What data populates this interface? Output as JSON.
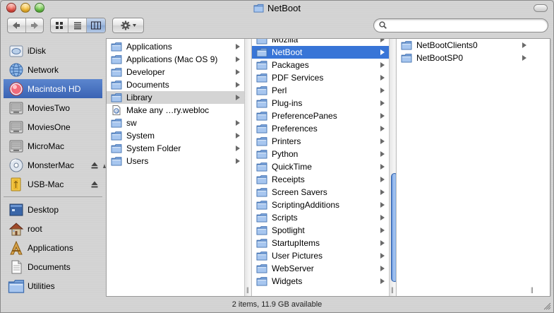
{
  "window": {
    "title": "NetBoot"
  },
  "toolbar": {
    "back_label": "Back",
    "forward_label": "Forward",
    "view_icon": "icon-view",
    "view_list": "list-view",
    "view_column": "column-view",
    "action_icon": "gear-icon"
  },
  "search": {
    "placeholder": "",
    "value": ""
  },
  "sidebar": {
    "devices": [
      {
        "label": "iDisk",
        "icon": "idisk-icon"
      },
      {
        "label": "Network",
        "icon": "network-globe-icon"
      },
      {
        "label": "Macintosh HD",
        "icon": "hard-disk-icon",
        "selected": true
      },
      {
        "label": "MoviesTwo",
        "icon": "drive-icon"
      },
      {
        "label": "MoviesOne",
        "icon": "drive-icon"
      },
      {
        "label": "MicroMac",
        "icon": "drive-icon"
      },
      {
        "label": "MonsterMac",
        "icon": "disk-icon",
        "eject": true
      },
      {
        "label": "USB-Mac",
        "icon": "usb-drive-icon",
        "eject": true
      }
    ],
    "places": [
      {
        "label": "Desktop",
        "icon": "desktop-icon"
      },
      {
        "label": "root",
        "icon": "home-icon"
      },
      {
        "label": "Applications",
        "icon": "applications-icon"
      },
      {
        "label": "Documents",
        "icon": "documents-icon"
      },
      {
        "label": "Utilities",
        "icon": "folder-icon"
      }
    ]
  },
  "columns": [
    {
      "items": [
        {
          "label": "Applications",
          "arrow": true
        },
        {
          "label": "Applications (Mac OS 9)",
          "arrow": true
        },
        {
          "label": "Developer",
          "arrow": true
        },
        {
          "label": "Documents",
          "arrow": true
        },
        {
          "label": "Library",
          "arrow": true,
          "state": "path"
        },
        {
          "label": "Make any …ry.webloc",
          "arrow": false,
          "icon": "webloc-icon"
        },
        {
          "label": "sw",
          "arrow": true
        },
        {
          "label": "System",
          "arrow": true
        },
        {
          "label": "System Folder",
          "arrow": true
        },
        {
          "label": "Users",
          "arrow": true
        }
      ]
    },
    {
      "items": [
        {
          "label": "Mozilla",
          "arrow": true
        },
        {
          "label": "NetBoot",
          "arrow": true,
          "state": "selected"
        },
        {
          "label": "Packages",
          "arrow": true
        },
        {
          "label": "PDF Services",
          "arrow": true
        },
        {
          "label": "Perl",
          "arrow": true
        },
        {
          "label": "Plug-ins",
          "arrow": true
        },
        {
          "label": "PreferencePanes",
          "arrow": true
        },
        {
          "label": "Preferences",
          "arrow": true
        },
        {
          "label": "Printers",
          "arrow": true
        },
        {
          "label": "Python",
          "arrow": true
        },
        {
          "label": "QuickTime",
          "arrow": true
        },
        {
          "label": "Receipts",
          "arrow": true
        },
        {
          "label": "Screen Savers",
          "arrow": true
        },
        {
          "label": "ScriptingAdditions",
          "arrow": true
        },
        {
          "label": "Scripts",
          "arrow": true
        },
        {
          "label": "Spotlight",
          "arrow": true
        },
        {
          "label": "StartupItems",
          "arrow": true
        },
        {
          "label": "User Pictures",
          "arrow": true
        },
        {
          "label": "WebServer",
          "arrow": true
        },
        {
          "label": "Widgets",
          "arrow": true
        }
      ]
    },
    {
      "items": [
        {
          "label": "NetBootClients0",
          "arrow": true
        },
        {
          "label": "NetBootSP0",
          "arrow": true
        }
      ]
    }
  ],
  "status": {
    "text": "2 items, 11.9 GB available"
  },
  "colors": {
    "selection": "#3875d7",
    "sidebar_selection": "#3a63b4",
    "path_highlight": "#d4d4d4"
  }
}
